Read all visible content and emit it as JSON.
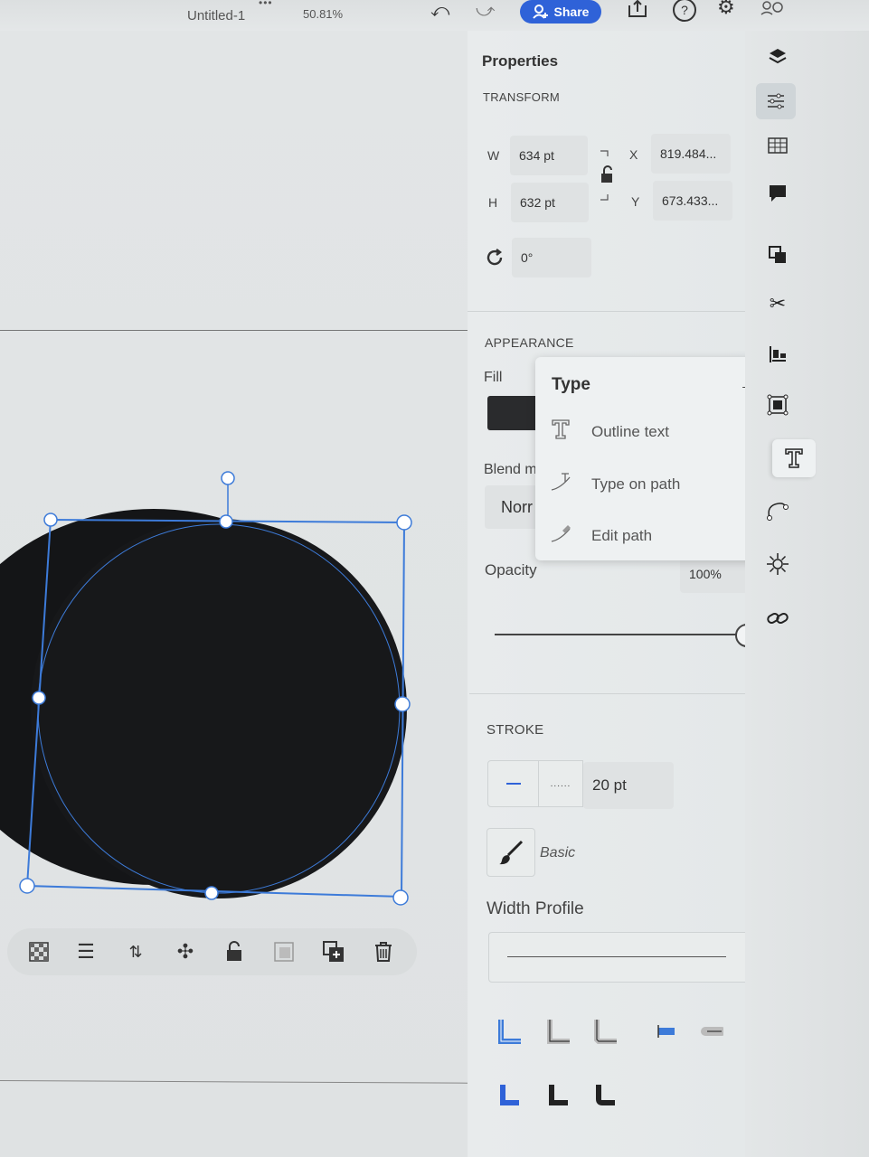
{
  "topbar": {
    "doc_title": "Untitled-1",
    "more_dots": "•••",
    "zoom": "50.81%",
    "share_label": "Share",
    "help": "?"
  },
  "panel": {
    "title": "Properties",
    "transform": {
      "section": "TRANSFORM",
      "w_label": "W",
      "w_value": "634 pt",
      "h_label": "H",
      "h_value": "632 pt",
      "x_label": "X",
      "x_value": "819.484...",
      "y_label": "Y",
      "y_value": "673.433...",
      "rotation_value": "0°"
    },
    "appearance": {
      "section": "APPEARANCE",
      "fill_label": "Fill",
      "fill_color": "#2a2b2d",
      "blend_label": "Blend m",
      "blend_value": "Norr",
      "opacity_label": "Opacity",
      "opacity_value": "100%",
      "opacity_level": 1.0
    },
    "stroke": {
      "section": "STROKE",
      "weight": "20 pt",
      "brush_label": "Basic",
      "width_profile_label": "Width Profile"
    }
  },
  "popover": {
    "title": "Type",
    "items": [
      {
        "label": "Outline text"
      },
      {
        "label": "Type on path"
      },
      {
        "label": "Edit path"
      }
    ]
  },
  "colors": {
    "accent": "#2f62d8",
    "selection": "#3d7bd9",
    "shape_fill": "#141517"
  }
}
